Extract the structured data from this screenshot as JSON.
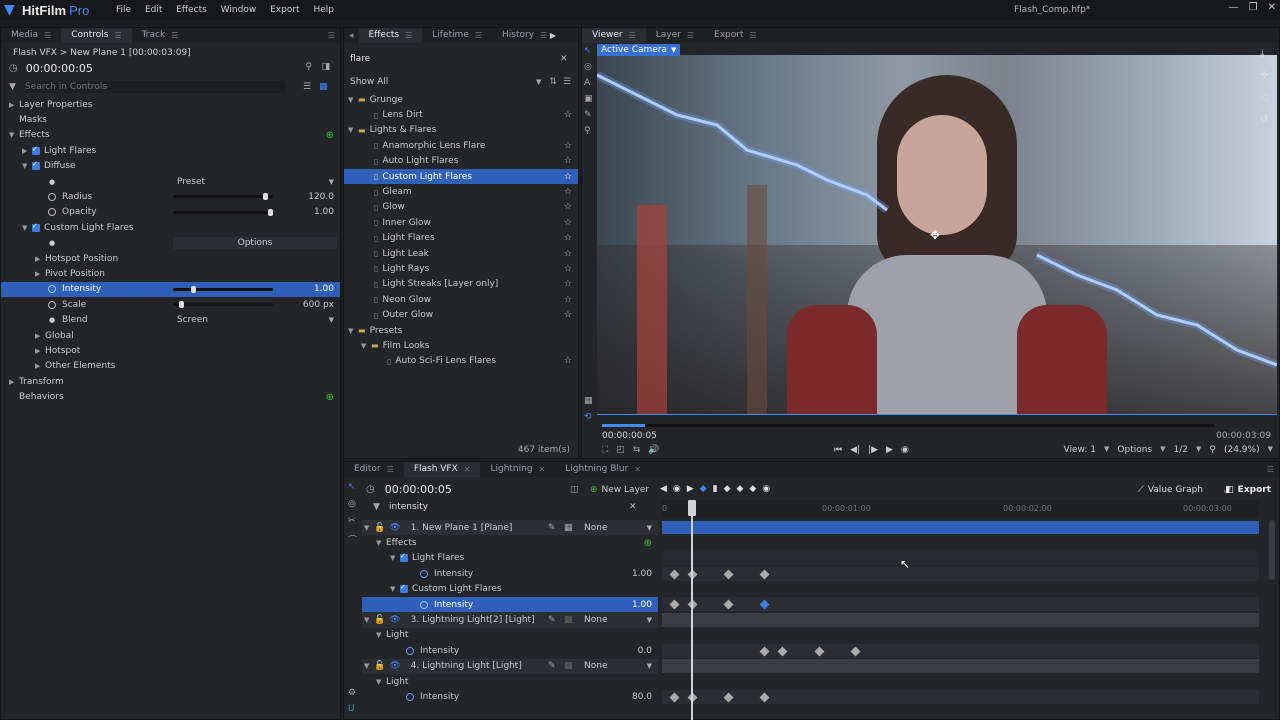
{
  "app": {
    "name": "HitFilm",
    "edition": "Pro",
    "menu": [
      "File",
      "Edit",
      "Effects",
      "Window",
      "Export",
      "Help"
    ],
    "file": "Flash_Comp.hfp*"
  },
  "left": {
    "tabs": [
      "Media",
      "Controls",
      "Track"
    ],
    "breadcrumb": "Flash VFX > New Plane 1 [00:00:03:09]",
    "time": "00:00:00:05",
    "search_placeholder": "Search in Controls",
    "rows": [
      "Layer Properties",
      "Masks",
      "Effects",
      "Light Flares",
      "Diffuse",
      "Preset",
      "Radius",
      "120.0",
      "Opacity",
      "1.00",
      "Custom Light Flares",
      "Options",
      "Hotspot Position",
      "Pivot Position",
      "Intensity",
      "1.00",
      "Scale",
      "600 px",
      "Blend",
      "Screen",
      "Global",
      "Hotspot",
      "Other Elements",
      "Transform",
      "Behaviors"
    ]
  },
  "effects": {
    "tabs": [
      "Effects",
      "Lifetime",
      "History"
    ],
    "search": "flare",
    "filter": "Show All",
    "count": "467 item(s)",
    "items": [
      "Grunge",
      "Lens Dirt",
      "Lights & Flares",
      "Anamorphic Lens Flare",
      "Auto Light Flares",
      "Custom Light Flares",
      "Gleam",
      "Glow",
      "Inner Glow",
      "Light Flares",
      "Light Leak",
      "Light Rays",
      "Light Streaks [Layer only]",
      "Neon Glow",
      "Outer Glow",
      "Presets",
      "Film Looks",
      "Auto Sci-Fi Lens Flares"
    ]
  },
  "viewer": {
    "tabs": [
      "Viewer",
      "Layer",
      "Export"
    ],
    "camera": "Active Camera",
    "time_start": "00:00:00:05",
    "time_end": "00:00:03:09",
    "view": "View: 1",
    "options": "Options",
    "res": "1/2",
    "zoom": "(24.9%)",
    "progress": 0.07
  },
  "timeline": {
    "tabs": [
      "Editor",
      "Flash VFX",
      "Lightning",
      "Lightning Blur"
    ],
    "time": "00:00:00:05",
    "new_layer": "New Layer",
    "value_graph": "Value Graph",
    "export": "Export",
    "search": "intensity",
    "ruler": [
      "0",
      "00:00:01:00",
      "00:00:02:00",
      "00:00:03:00"
    ],
    "rows": [
      "1. New Plane 1 [Plane]",
      "None",
      "Effects",
      "Light Flares",
      "Intensity",
      "1.00",
      "Custom Light Flares",
      "Intensity",
      "1.00",
      "3. Lightning Light[2] [Light]",
      "None",
      "Light",
      "Intensity",
      "0.0",
      "4. Lightning Light [Light]",
      "None",
      "Light",
      "Intensity",
      "80.0"
    ]
  },
  "colors": {
    "accent": "#3d8bff",
    "selection": "#2f5fb8"
  }
}
